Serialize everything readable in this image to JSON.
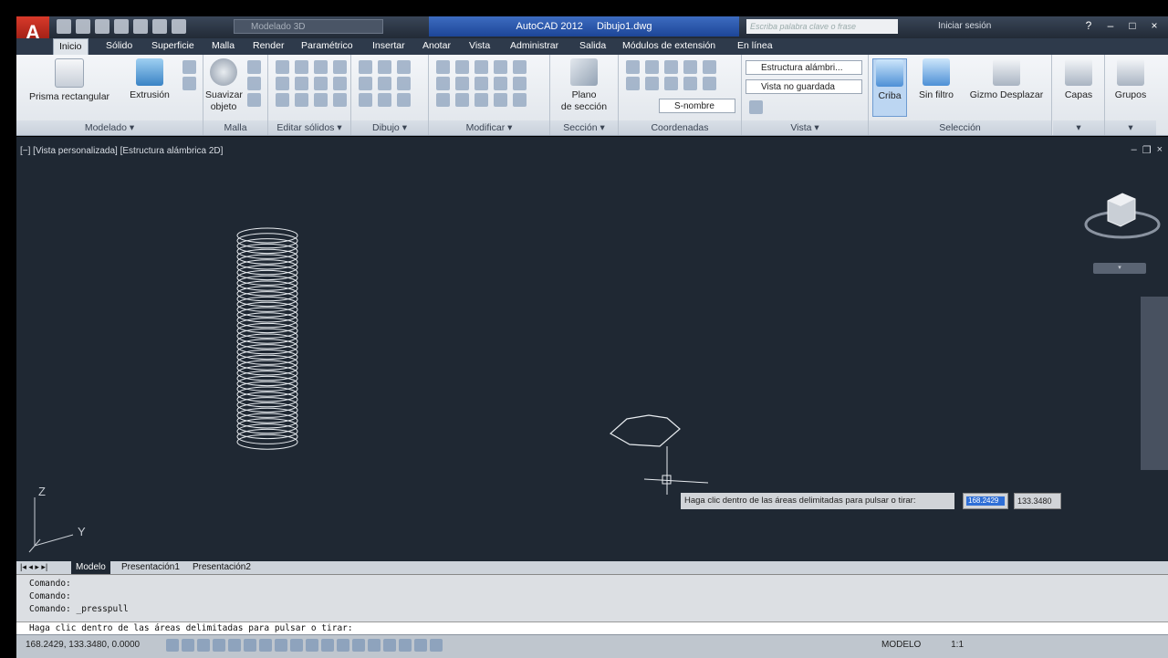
{
  "app": {
    "title_app": "AutoCAD 2012",
    "title_file": "Dibujo1.dwg",
    "workspace": "Modelado 3D",
    "search_placeholder": "Escriba palabra clave o frase",
    "signin": "Iniciar sesión"
  },
  "tabs": [
    "Inicio",
    "Sólido",
    "Superficie",
    "Malla",
    "Render",
    "Paramétrico",
    "Insertar",
    "Anotar",
    "Vista",
    "Administrar",
    "Salida",
    "Módulos de extensión",
    "En línea"
  ],
  "ribbon": {
    "prisma": "Prisma rectangular",
    "extrusion": "Extrusión",
    "suavizar_1": "Suavizar",
    "suavizar_2": "objeto",
    "plano_1": "Plano",
    "plano_2": "de sección",
    "estructura": "Estructura alámbri...",
    "vista_no_guardada": "Vista no guardada",
    "snombre": "S-nombre",
    "criba": "Criba",
    "sinfiltro": "Sin filtro",
    "gizmo": "Gizmo Desplazar",
    "capas": "Capas",
    "grupos": "Grupos",
    "panels": [
      "Modelado",
      "Malla",
      "Editar sólidos",
      "Dibujo",
      "Modificar",
      "Sección",
      "Coordenadas",
      "Vista",
      "Selección"
    ]
  },
  "viewport": {
    "label": "[−] [Vista personalizada] [Estructura alámbrica 2D]",
    "tooltip": "Haga clic dentro de las áreas delimitadas para pulsar o tirar:",
    "dyn_value_1": "168.2429",
    "dyn_value_2": "133.3480",
    "axis_z": "Z",
    "axis_y": "Y"
  },
  "layout_tabs": [
    "Modelo",
    "Presentación1",
    "Presentación2"
  ],
  "command": {
    "lines": [
      "Comando:",
      "Comando:",
      "Comando: _presspull"
    ],
    "prompt": "Haga clic dentro de las áreas delimitadas para pulsar o tirar:"
  },
  "status": {
    "coords": "168.2429, 133.3480, 0.0000",
    "modelo": "MODELO",
    "scale": "1:1"
  }
}
